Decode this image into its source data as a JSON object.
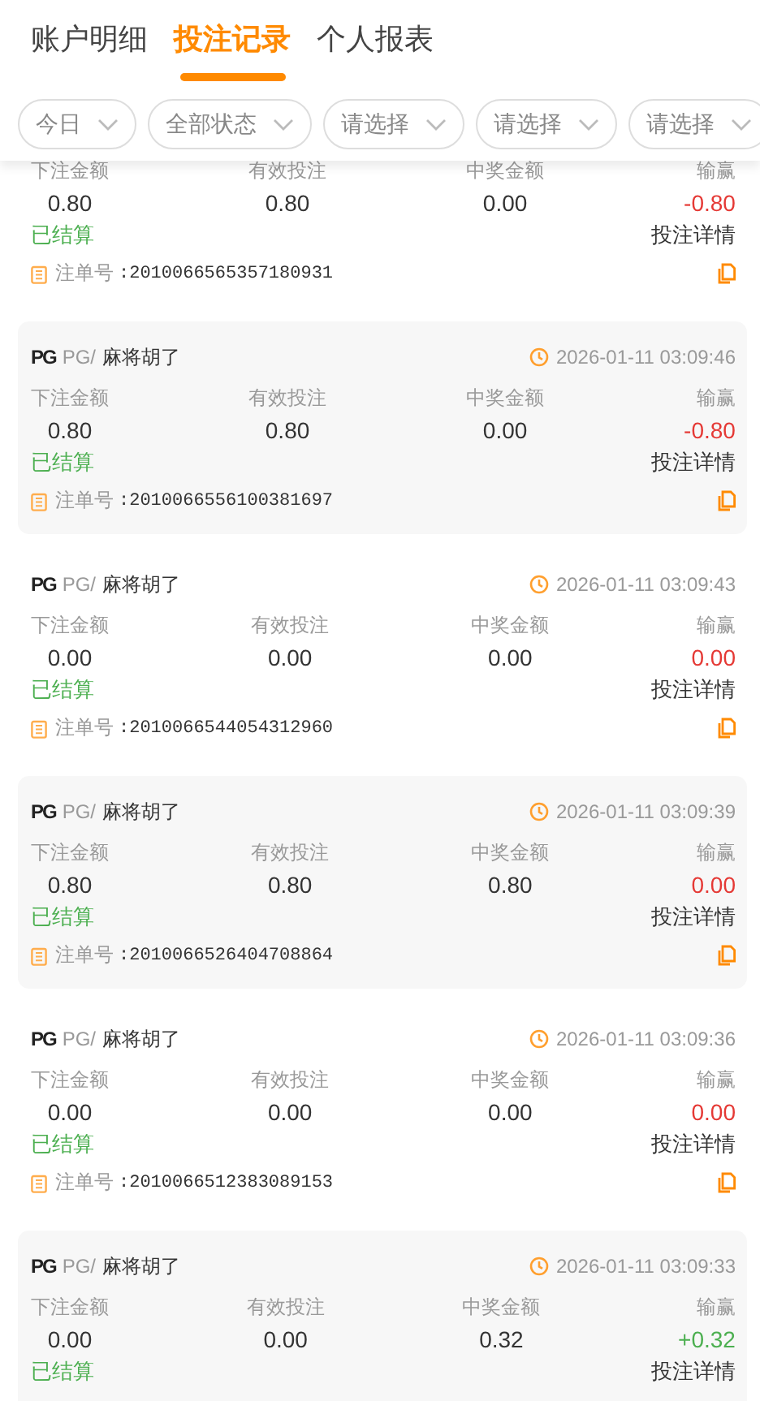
{
  "tabs": [
    {
      "label": "账户明细",
      "selected": false
    },
    {
      "label": "投注记录",
      "selected": true
    },
    {
      "label": "个人报表",
      "selected": false
    }
  ],
  "filters": [
    {
      "label": "今日"
    },
    {
      "label": "全部状态"
    },
    {
      "label": "请选择"
    },
    {
      "label": "请选择"
    },
    {
      "label": "请选择"
    }
  ],
  "records": [
    {
      "labels": [
        "下注金额",
        "有效投注",
        "中奖金额",
        "输赢"
      ],
      "stake": "0.80",
      "valid": "0.80",
      "payout": "0.00",
      "result": "-0.80",
      "color": "#e53935",
      "status": "已结算",
      "detail": "投注详情",
      "order_label": "注单号",
      "order_no": ":2010066565357180931"
    },
    {
      "provider": "PG",
      "provider_name": "PG/",
      "game": "麻将胡了",
      "time": "2026-01-11 03:09:46",
      "labels": [
        "下注金额",
        "有效投注",
        "中奖金额",
        "输赢"
      ],
      "stake": "0.80",
      "valid": "0.80",
      "payout": "0.00",
      "result": "-0.80",
      "color": "#e53935",
      "status": "已结算",
      "detail": "投注详情",
      "order_label": "注单号",
      "order_no": ":2010066556100381697"
    },
    {
      "provider": "PG",
      "provider_name": "PG/",
      "game": "麻将胡了",
      "time": "2026-01-11 03:09:43",
      "labels": [
        "下注金额",
        "有效投注",
        "中奖金额",
        "输赢"
      ],
      "stake": "0.00",
      "valid": "0.00",
      "payout": "0.00",
      "result": "0.00",
      "color": "#e53935",
      "status": "已结算",
      "detail": "投注详情",
      "order_label": "注单号",
      "order_no": ":2010066544054312960"
    },
    {
      "provider": "PG",
      "provider_name": "PG/",
      "game": "麻将胡了",
      "time": "2026-01-11 03:09:39",
      "labels": [
        "下注金额",
        "有效投注",
        "中奖金额",
        "输赢"
      ],
      "stake": "0.80",
      "valid": "0.80",
      "payout": "0.80",
      "result": "0.00",
      "color": "#e53935",
      "status": "已结算",
      "detail": "投注详情",
      "order_label": "注单号",
      "order_no": ":2010066526404708864"
    },
    {
      "provider": "PG",
      "provider_name": "PG/",
      "game": "麻将胡了",
      "time": "2026-01-11 03:09:36",
      "labels": [
        "下注金额",
        "有效投注",
        "中奖金额",
        "输赢"
      ],
      "stake": "0.00",
      "valid": "0.00",
      "payout": "0.00",
      "result": "0.00",
      "color": "#e53935",
      "status": "已结算",
      "detail": "投注详情",
      "order_label": "注单号",
      "order_no": ":2010066512383089153"
    },
    {
      "provider": "PG",
      "provider_name": "PG/",
      "game": "麻将胡了",
      "time": "2026-01-11 03:09:33",
      "labels": [
        "下注金额",
        "有效投注",
        "中奖金额",
        "输赢"
      ],
      "stake": "0.00",
      "valid": "0.00",
      "payout": "0.32",
      "result": "+0.32",
      "color": "#4caf50",
      "status": "已结算",
      "detail": "投注详情"
    }
  ]
}
